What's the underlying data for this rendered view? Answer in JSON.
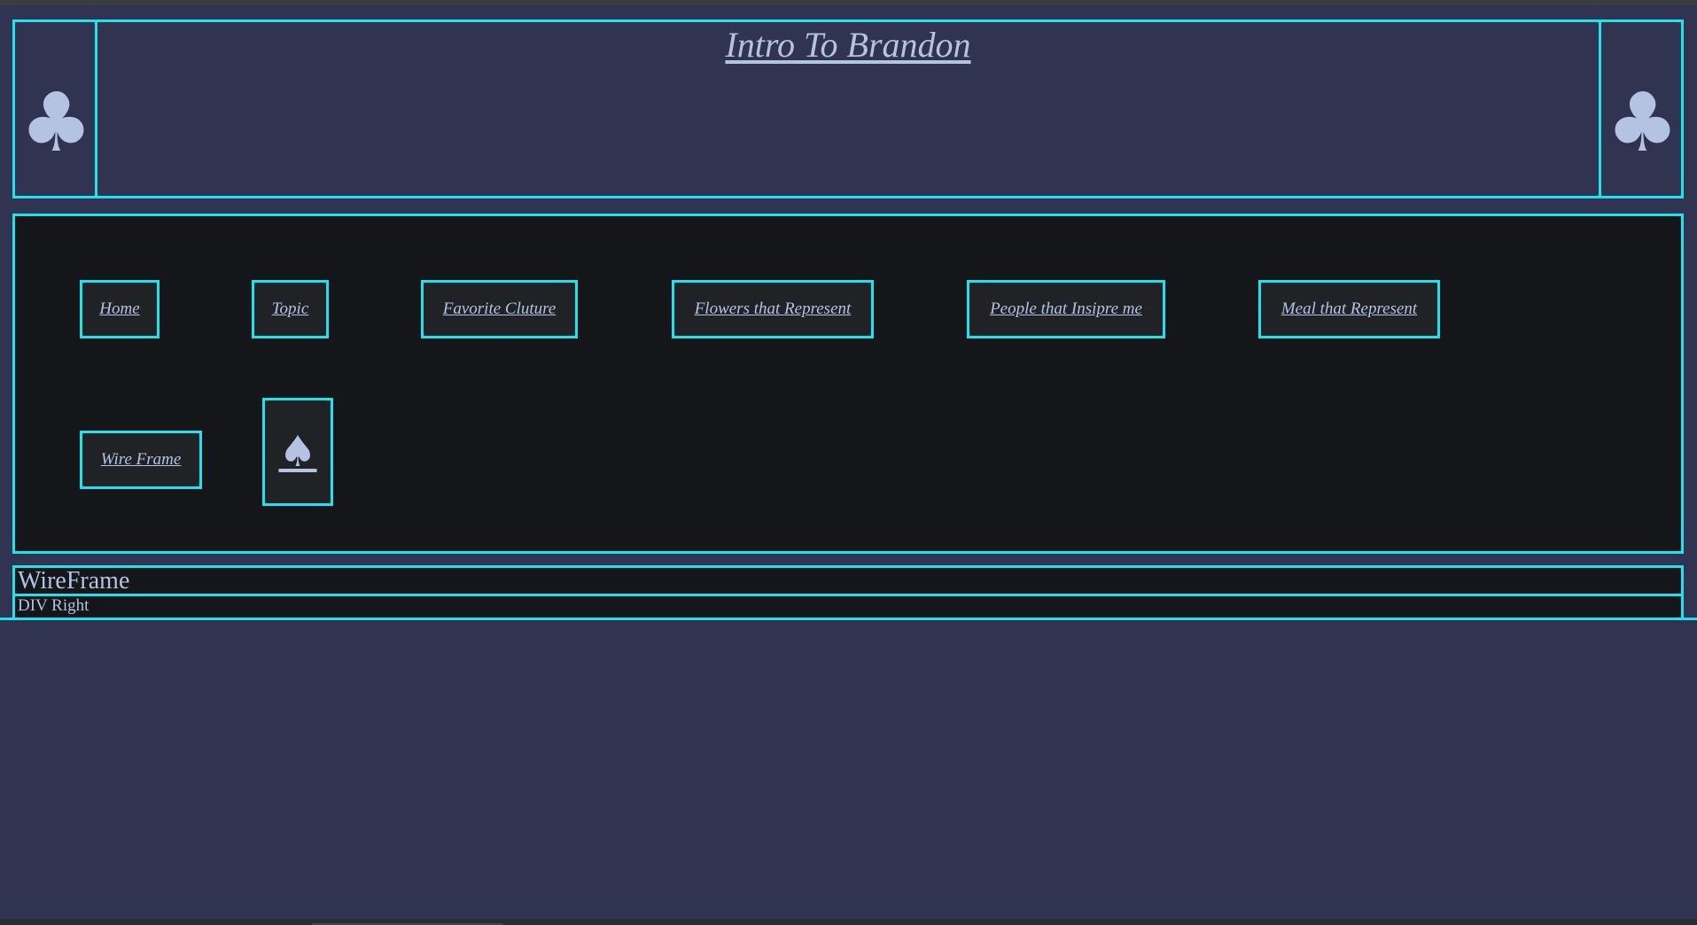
{
  "header": {
    "title": "Intro To Brandon",
    "left_icon": "club-icon",
    "right_icon": "club-icon"
  },
  "nav": {
    "items": [
      {
        "label": "Home"
      },
      {
        "label": "Topic"
      },
      {
        "label": "Favorite Cluture"
      },
      {
        "label": "Flowers that Represent"
      },
      {
        "label": "People that Insipre me"
      },
      {
        "label": "Meal that Represent"
      },
      {
        "label": "Wire Frame"
      }
    ],
    "extra_icon": "spade-icon"
  },
  "wireframe": {
    "heading": "WireFrame",
    "div_right": "DIV Right"
  },
  "colors": {
    "background": "#303451",
    "panel": "#141619",
    "border": "#1fe2ee",
    "text": "#b4c3e2"
  }
}
